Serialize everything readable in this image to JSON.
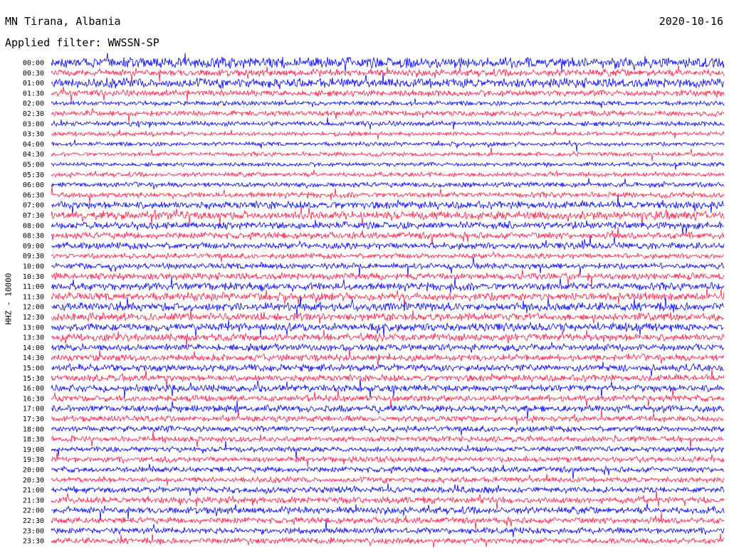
{
  "header": {
    "station": "MN Tirana, Albania",
    "date": "2020-10-16",
    "filter": "Applied filter: WWSSN-SP"
  },
  "chart_data": {
    "type": "line",
    "subtype": "helicorder",
    "channel_label": "HHZ - 10000",
    "trace_colors": [
      "#0000ff",
      "#ff1744"
    ],
    "rows": [
      {
        "time": "00:00",
        "activity": 0.95,
        "seed": 3
      },
      {
        "time": "00:30",
        "activity": 0.55,
        "seed": 7
      },
      {
        "time": "01:00",
        "activity": 0.8,
        "seed": 11
      },
      {
        "time": "01:30",
        "activity": 0.45,
        "seed": 13
      },
      {
        "time": "02:00",
        "activity": 0.25,
        "seed": 17
      },
      {
        "time": "02:30",
        "activity": 0.35,
        "seed": 19
      },
      {
        "time": "03:00",
        "activity": 0.3,
        "seed": 23
      },
      {
        "time": "03:30",
        "activity": 0.2,
        "seed": 29
      },
      {
        "time": "04:00",
        "activity": 0.2,
        "seed": 31
      },
      {
        "time": "04:30",
        "activity": 0.2,
        "seed": 37
      },
      {
        "time": "05:00",
        "activity": 0.2,
        "seed": 41
      },
      {
        "time": "05:30",
        "activity": 0.25,
        "seed": 43
      },
      {
        "time": "06:00",
        "activity": 0.3,
        "seed": 47
      },
      {
        "time": "06:30",
        "activity": 0.35,
        "seed": 53
      },
      {
        "time": "07:00",
        "activity": 0.6,
        "seed": 59
      },
      {
        "time": "07:30",
        "activity": 0.7,
        "seed": 61
      },
      {
        "time": "08:00",
        "activity": 0.55,
        "seed": 67
      },
      {
        "time": "08:30",
        "activity": 0.5,
        "seed": 71
      },
      {
        "time": "09:00",
        "activity": 0.5,
        "seed": 73
      },
      {
        "time": "09:30",
        "activity": 0.35,
        "seed": 79
      },
      {
        "time": "10:00",
        "activity": 0.4,
        "seed": 83
      },
      {
        "time": "10:30",
        "activity": 0.5,
        "seed": 89
      },
      {
        "time": "11:00",
        "activity": 0.6,
        "seed": 97
      },
      {
        "time": "11:30",
        "activity": 0.65,
        "seed": 101
      },
      {
        "time": "12:00",
        "activity": 0.7,
        "seed": 103
      },
      {
        "time": "12:30",
        "activity": 0.65,
        "seed": 107
      },
      {
        "time": "13:00",
        "activity": 0.7,
        "seed": 109
      },
      {
        "time": "13:30",
        "activity": 0.6,
        "seed": 113
      },
      {
        "time": "14:00",
        "activity": 0.55,
        "seed": 127
      },
      {
        "time": "14:30",
        "activity": 0.5,
        "seed": 131
      },
      {
        "time": "15:00",
        "activity": 0.55,
        "seed": 137
      },
      {
        "time": "15:30",
        "activity": 0.5,
        "seed": 139
      },
      {
        "time": "16:00",
        "activity": 0.55,
        "seed": 149
      },
      {
        "time": "16:30",
        "activity": 0.45,
        "seed": 151
      },
      {
        "time": "17:00",
        "activity": 0.55,
        "seed": 157
      },
      {
        "time": "17:30",
        "activity": 0.4,
        "seed": 163
      },
      {
        "time": "18:00",
        "activity": 0.4,
        "seed": 167
      },
      {
        "time": "18:30",
        "activity": 0.35,
        "seed": 173
      },
      {
        "time": "19:00",
        "activity": 0.35,
        "seed": 179
      },
      {
        "time": "19:30",
        "activity": 0.4,
        "seed": 181
      },
      {
        "time": "20:00",
        "activity": 0.4,
        "seed": 191
      },
      {
        "time": "20:30",
        "activity": 0.35,
        "seed": 193
      },
      {
        "time": "21:00",
        "activity": 0.45,
        "seed": 197
      },
      {
        "time": "21:30",
        "activity": 0.45,
        "seed": 199
      },
      {
        "time": "22:00",
        "activity": 0.55,
        "seed": 211
      },
      {
        "time": "22:30",
        "activity": 0.45,
        "seed": 223
      },
      {
        "time": "23:00",
        "activity": 0.45,
        "seed": 227
      },
      {
        "time": "23:30",
        "activity": 0.4,
        "seed": 229
      }
    ]
  }
}
